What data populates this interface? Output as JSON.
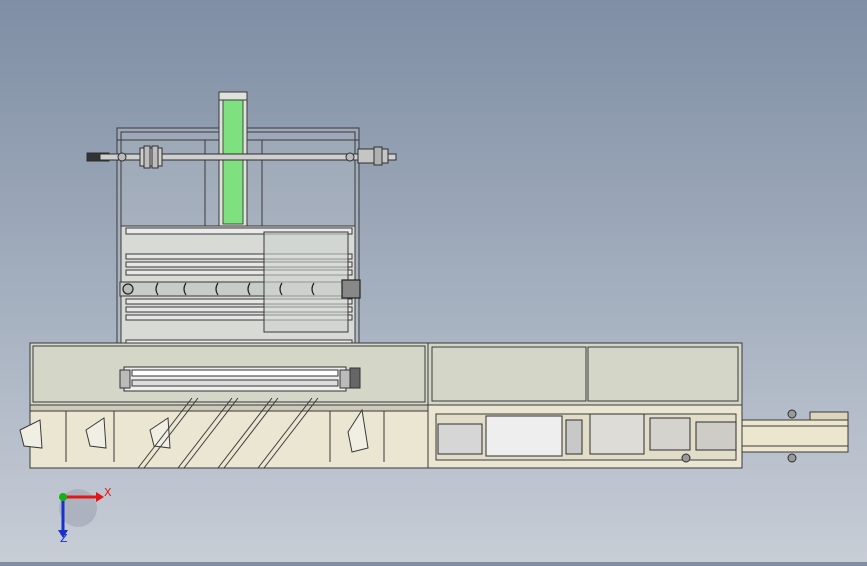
{
  "viewport": {
    "background_top": "#7f8ea4",
    "background_bottom": "#c8cdd6"
  },
  "model": {
    "frame_color": "#3a3a3a",
    "panel_fill": "#d4d6c8",
    "base_fill": "#ebe6d2",
    "conveyor_belt_color": "#7fe07f",
    "rod_color": "#c8c8c8"
  },
  "triad": {
    "x_label": "X",
    "z_label": "Z",
    "x_color": "#e01818",
    "y_color": "#18b018",
    "z_color": "#1830d0"
  }
}
